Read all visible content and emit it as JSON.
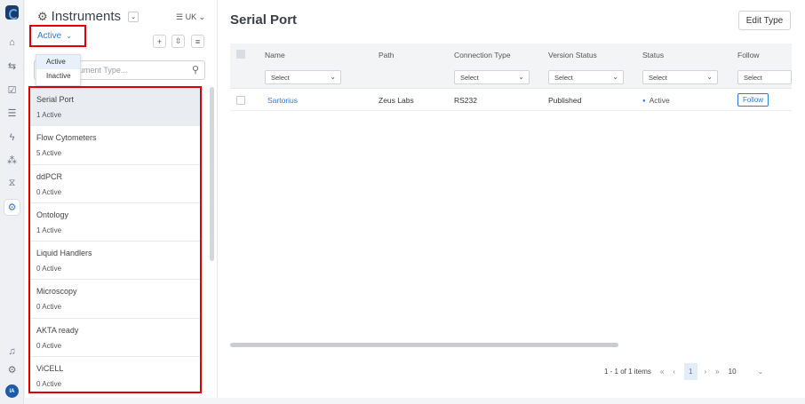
{
  "sidebar": {
    "title": "Instruments",
    "language": "UK",
    "status_filter": "Active",
    "status_options": [
      "Active",
      "Inactive"
    ],
    "search_placeholder": "ument Type...",
    "items": [
      {
        "name": "Serial Port",
        "count": "1 Active"
      },
      {
        "name": "Flow Cytometers",
        "count": "5 Active"
      },
      {
        "name": "ddPCR",
        "count": "0 Active"
      },
      {
        "name": "Ontology",
        "count": "1 Active"
      },
      {
        "name": "Liquid Handlers",
        "count": "0 Active"
      },
      {
        "name": "Microscopy",
        "count": "0 Active"
      },
      {
        "name": "AKTA ready",
        "count": "0 Active"
      },
      {
        "name": "ViCELL",
        "count": "0 Active"
      }
    ]
  },
  "main": {
    "title": "Serial Port",
    "edit_button": "Edit Type",
    "columns": [
      "Name",
      "Path",
      "Connection Type",
      "Version Status",
      "Status",
      "Follow"
    ],
    "filter_placeholder": "Select",
    "rows": [
      {
        "name": "Sartorius",
        "path": "Zeus Labs",
        "connection": "RS232",
        "version_status": "Published",
        "status": "Active",
        "follow": "Follow"
      }
    ],
    "pagination": {
      "range": "1 - 1 of 1 items",
      "current_page": "1",
      "page_size": "10"
    }
  },
  "user": {
    "initials": "IA"
  },
  "colors": {
    "accent": "#2a7de1",
    "highlight": "#e00000"
  }
}
